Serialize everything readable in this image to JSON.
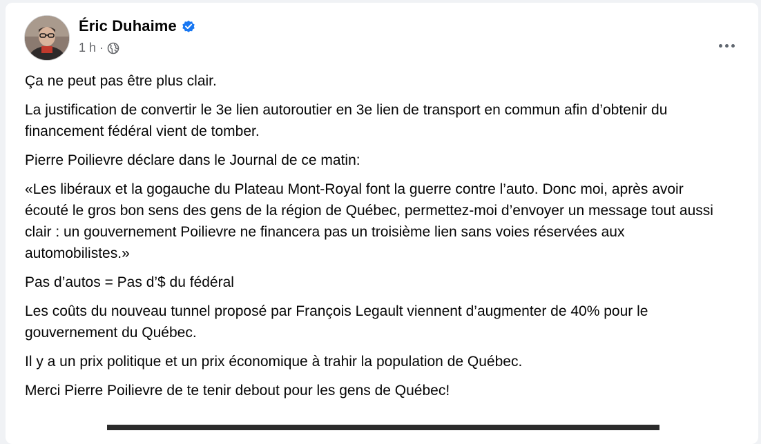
{
  "post": {
    "author": {
      "name": "Éric Duhaime",
      "verified": true,
      "avatar_icon": "profile-photo"
    },
    "timestamp": "1 h",
    "separator": "·",
    "audience_icon": "globe-icon",
    "more_icon": "more-horizontal-icon",
    "paragraphs": [
      "Ça ne peut pas être plus clair.",
      "La justification de convertir le 3e lien autoroutier en 3e lien de transport en commun afin d’obtenir du financement fédéral vient de tomber.",
      "Pierre Poilievre déclare dans le Journal de ce matin:",
      "«Les libéraux et la gogauche du Plateau Mont-Royal font la guerre contre l’auto. Donc moi, après avoir écouté le gros bon sens des gens de la région de Québec, permettez-moi d’envoyer un message tout aussi clair : un gouvernement Poilievre ne financera pas un troisième lien sans voies réservées aux automobilistes.»",
      "Pas d’autos = Pas d’$ du fédéral",
      "Les coûts du nouveau tunnel proposé par François Legault viennent d’augmenter de 40% pour le gouvernement du Québec.",
      "Il y a un prix politique et un prix économique à trahir la population de Québec.",
      "Merci Pierre Poilievre de te tenir debout pour les gens de Québec!"
    ]
  },
  "colors": {
    "background": "#f0f2f5",
    "card": "#ffffff",
    "text_primary": "#050505",
    "text_secondary": "#65676b",
    "verified_blue": "#1877f2"
  }
}
